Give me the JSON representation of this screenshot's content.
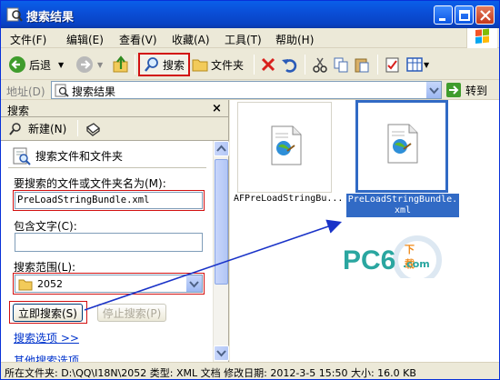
{
  "window": {
    "title": "搜索结果"
  },
  "menu": {
    "items": [
      "文件(F)",
      "编辑(E)",
      "查看(V)",
      "收藏(A)",
      "工具(T)",
      "帮助(H)"
    ]
  },
  "toolbar": {
    "back_label": "后退",
    "search_label": "搜索",
    "folders_label": "文件夹"
  },
  "address": {
    "label": "地址(D)",
    "value": "搜索结果",
    "go_label": "转到"
  },
  "search_pane": {
    "title": "搜索",
    "close": "×",
    "new_label": "新建(N)",
    "section_title": "搜索文件和文件夹",
    "name_label": "要搜索的文件或文件夹名为(M):",
    "name_value": "PreLoadStringBundle.xml",
    "text_label": "包含文字(C):",
    "text_value": "",
    "scope_label": "搜索范围(L):",
    "scope_value": "2052",
    "search_now": "立即搜索(S)",
    "stop": "停止搜索(P)",
    "options_link": "搜索选项 >>",
    "other_link": "其他搜索选项"
  },
  "results": {
    "items": [
      {
        "name": "AFPreLoadStringBu...",
        "selected": false
      },
      {
        "name": "PreLoadStringBundle.xml",
        "selected": true
      }
    ]
  },
  "watermark": {
    "text": "PC6",
    "sub1": "下载",
    "sub2": ".com"
  },
  "status": {
    "text": "所在文件夹: D:\\QQ\\I18N\\2052 类型: XML 文档 修改日期: 2012-3-5 15:50 大小: 16.0 KB"
  },
  "colors": {
    "title_bar": "#0a4fd8",
    "highlight_red": "#d21010",
    "selection_blue": "#316ac5",
    "arrow_blue": "#1a33c8"
  }
}
